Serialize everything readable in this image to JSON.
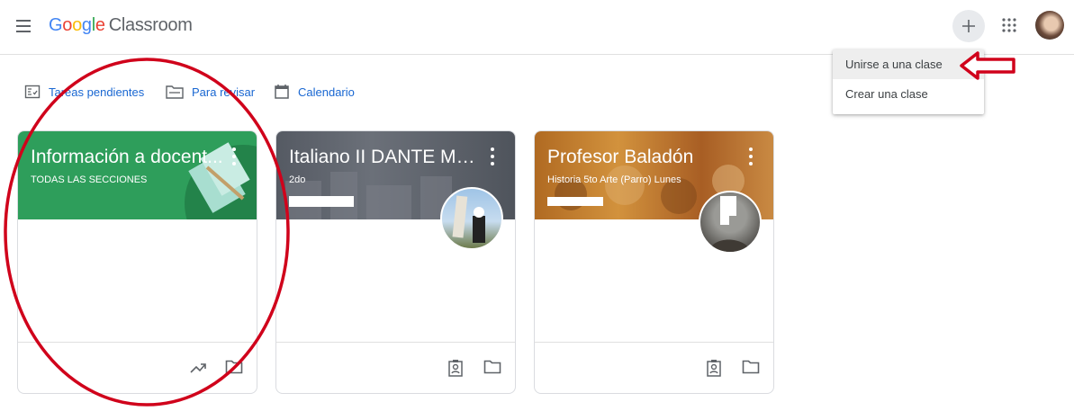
{
  "header": {
    "logo_google": [
      "G",
      "o",
      "o",
      "g",
      "l",
      "e"
    ],
    "logo_product": "Classroom"
  },
  "menu": {
    "items": [
      {
        "label": "Unirse a una clase"
      },
      {
        "label": "Crear una clase"
      }
    ]
  },
  "toolbar": {
    "links": [
      {
        "label": "Tareas pendientes"
      },
      {
        "label": "Para revisar"
      },
      {
        "label": "Calendario"
      }
    ]
  },
  "cards": [
    {
      "title": "Información a docent...",
      "subtitle": "TODAS LAS SECCIONES",
      "color": "#2e9e5b"
    },
    {
      "title": "Italiano II DANTE MER...",
      "subtitle": "2do",
      "color": "#5f6368"
    },
    {
      "title": "Profesor Baladón",
      "subtitle": "Historia 5to Arte (Parro) Lunes",
      "color": "#c57b2a"
    }
  ],
  "colors": {
    "link": "#1967d2",
    "annotation": "#d0021b"
  }
}
